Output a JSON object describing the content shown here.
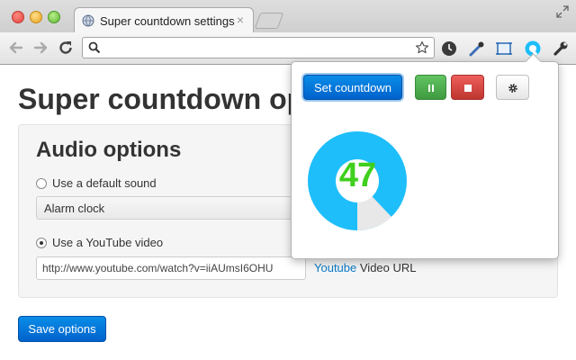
{
  "browser": {
    "tab_title": "Super countdown settings",
    "tab_close": "×"
  },
  "page": {
    "title": "Super countdown options",
    "section_title": "Audio options",
    "default_sound_label": "Use a default sound",
    "default_sound_selected": "Alarm clock",
    "youtube_label": "Use a YouTube video",
    "youtube_url_value": "http://www.youtube.com/watch?v=iiAUmsI6OHU",
    "youtube_link": "Youtube",
    "youtube_hint_suffix": "Video URL",
    "selected_option": "youtube",
    "save_button": "Save options"
  },
  "popup": {
    "set_countdown_button": "Set countdown",
    "timer_value": "47",
    "timer_colors": {
      "ring": "#1ebefa",
      "remaining": "#e8e8e8",
      "number": "#3ed01c"
    }
  },
  "icons": [
    "back-arrow-icon",
    "forward-arrow-icon",
    "reload-icon",
    "search-icon",
    "star-icon",
    "clock-icon",
    "eyedropper-icon",
    "screen-capture-icon",
    "countdown-extension-icon",
    "wrench-icon",
    "pause-icon",
    "stop-icon",
    "gear-icon"
  ]
}
